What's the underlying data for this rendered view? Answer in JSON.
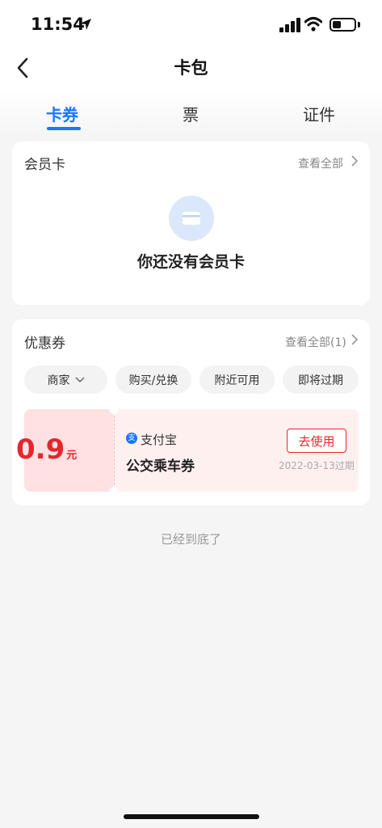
{
  "status_bar": {
    "time": "11:54"
  },
  "nav": {
    "title": "卡包"
  },
  "tabs": [
    {
      "label": "卡券",
      "active": true
    },
    {
      "label": "票",
      "active": false
    },
    {
      "label": "证件",
      "active": false
    }
  ],
  "membership": {
    "title": "会员卡",
    "view_all": "查看全部",
    "empty_text": "你还没有会员卡"
  },
  "coupons": {
    "title": "优惠券",
    "view_all": "查看全部(1)",
    "filters": [
      "商家",
      "购买/兑换",
      "附近可用",
      "即将过期"
    ],
    "items": [
      {
        "amount": "0.9",
        "unit": "元",
        "brand": "支付宝",
        "name": "公交乘车券",
        "action": "去使用",
        "expire": "2022-03-13过期"
      }
    ]
  },
  "footer": {
    "end_text": "已经到底了"
  },
  "colors": {
    "accent": "#1677ff",
    "coupon_red": "#e5262f"
  },
  "icons": [
    "location-arrow-icon",
    "signal-icon",
    "wifi-icon",
    "battery-icon",
    "back-arrow-icon",
    "card-icon",
    "chevron-right-icon",
    "chevron-down-icon",
    "alipay-icon"
  ]
}
